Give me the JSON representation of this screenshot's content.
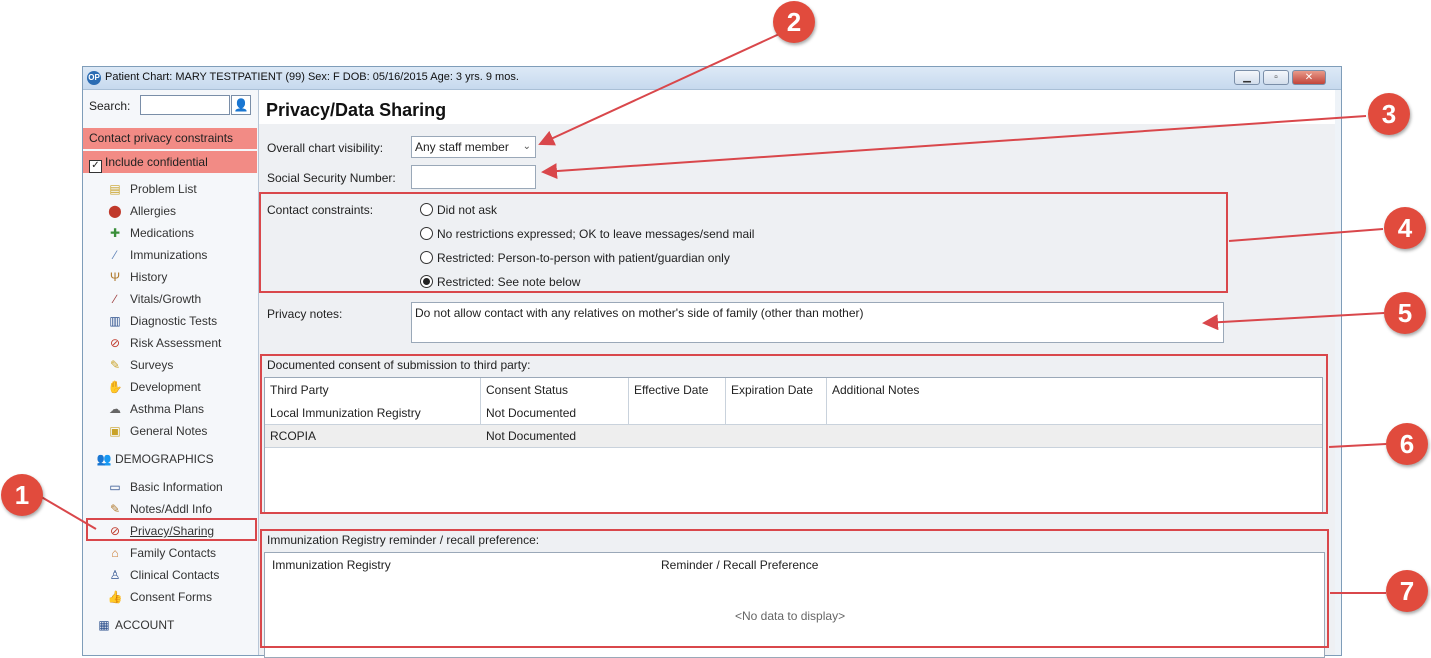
{
  "window": {
    "title": "Patient Chart: MARY TESTPATIENT (99)  Sex: F  DOB: 05/16/2015  Age: 3 yrs. 9 mos.",
    "app_logo": "OP"
  },
  "sidebar": {
    "search_label": "Search:",
    "search_value": "",
    "contact_warning": "Contact privacy constraints",
    "include_confidential": "Include confidential",
    "items": [
      {
        "label": "Problem List",
        "icon": "problem-list-icon"
      },
      {
        "label": "Allergies",
        "icon": "allergies-icon"
      },
      {
        "label": "Medications",
        "icon": "medications-icon"
      },
      {
        "label": "Immunizations",
        "icon": "immunizations-icon"
      },
      {
        "label": "History",
        "icon": "history-icon"
      },
      {
        "label": "Vitals/Growth",
        "icon": "vitals-icon"
      },
      {
        "label": "Diagnostic Tests",
        "icon": "diagnostic-tests-icon"
      },
      {
        "label": "Risk Assessment",
        "icon": "risk-assessment-icon"
      },
      {
        "label": "Surveys",
        "icon": "surveys-icon"
      },
      {
        "label": "Development",
        "icon": "development-icon"
      },
      {
        "label": "Asthma Plans",
        "icon": "asthma-plans-icon"
      },
      {
        "label": "General Notes",
        "icon": "general-notes-icon"
      }
    ],
    "demographics_label": "DEMOGRAPHICS",
    "demographics_items": [
      {
        "label": "Basic Information"
      },
      {
        "label": "Notes/Addl Info"
      },
      {
        "label": "Privacy/Sharing"
      },
      {
        "label": "Family Contacts"
      },
      {
        "label": "Clinical Contacts"
      },
      {
        "label": "Consent Forms"
      }
    ],
    "account_label": "ACCOUNT"
  },
  "main": {
    "title": "Privacy/Data Sharing",
    "visibility_label": "Overall chart visibility:",
    "visibility_value": "Any staff member",
    "ssn_label": "Social Security Number:",
    "ssn_value": "",
    "contact_label": "Contact constraints:",
    "contact_options": [
      "Did not ask",
      "No restrictions expressed; OK to leave messages/send mail",
      "Restricted: Person-to-person with patient/guardian only",
      "Restricted: See note below"
    ],
    "contact_selected": 3,
    "privacy_notes_label": "Privacy notes:",
    "privacy_notes_value": "Do not allow contact with any relatives on mother's side of family (other than mother)",
    "consent": {
      "title": "Documented consent of submission to third party:",
      "columns": [
        "Third Party",
        "Consent Status",
        "Effective Date",
        "Expiration Date",
        "Additional Notes"
      ],
      "rows": [
        [
          "Local Immunization Registry",
          "Not Documented",
          "",
          "",
          ""
        ],
        [
          "RCOPIA",
          "Not Documented",
          "",
          "",
          ""
        ]
      ]
    },
    "registry": {
      "title": "Immunization Registry reminder / recall preference:",
      "columns": [
        "Immunization Registry",
        "Reminder / Recall Preference"
      ],
      "empty_text": "<No data to display>"
    }
  },
  "callouts": [
    "1",
    "2",
    "3",
    "4",
    "5",
    "6",
    "7"
  ],
  "colors": {
    "callout": "#e14b3d",
    "highlight_box": "#d9474b",
    "warning_bg": "#f28b85"
  }
}
